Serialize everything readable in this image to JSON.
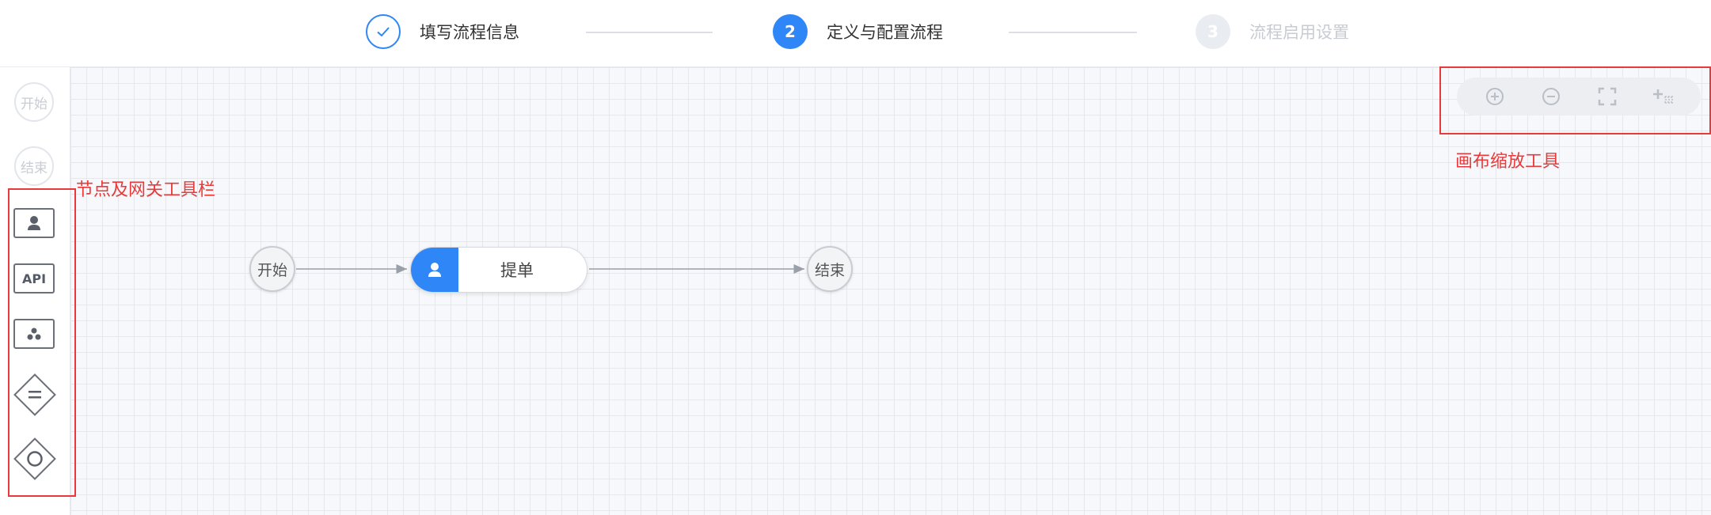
{
  "steps": [
    {
      "label": "填写流程信息",
      "state": "done",
      "number": ""
    },
    {
      "label": "定义与配置流程",
      "state": "active",
      "number": "2"
    },
    {
      "label": "流程启用设置",
      "state": "pending",
      "number": "3"
    }
  ],
  "palette": {
    "start_label": "开始",
    "end_label": "结束",
    "api_label": "API"
  },
  "annotations": {
    "palette_note": "节点及网关工具栏",
    "zoom_note": "画布缩放工具"
  },
  "zoom_toolbar": {
    "buttons": [
      "zoom-in-icon",
      "zoom-out-icon",
      "fit-screen-icon",
      "actual-size-icon"
    ]
  },
  "flow": {
    "start_label": "开始",
    "task_label": "提单",
    "end_label": "结束"
  },
  "colors": {
    "primary": "#2f86f6",
    "annotation": "#e83a3a"
  }
}
